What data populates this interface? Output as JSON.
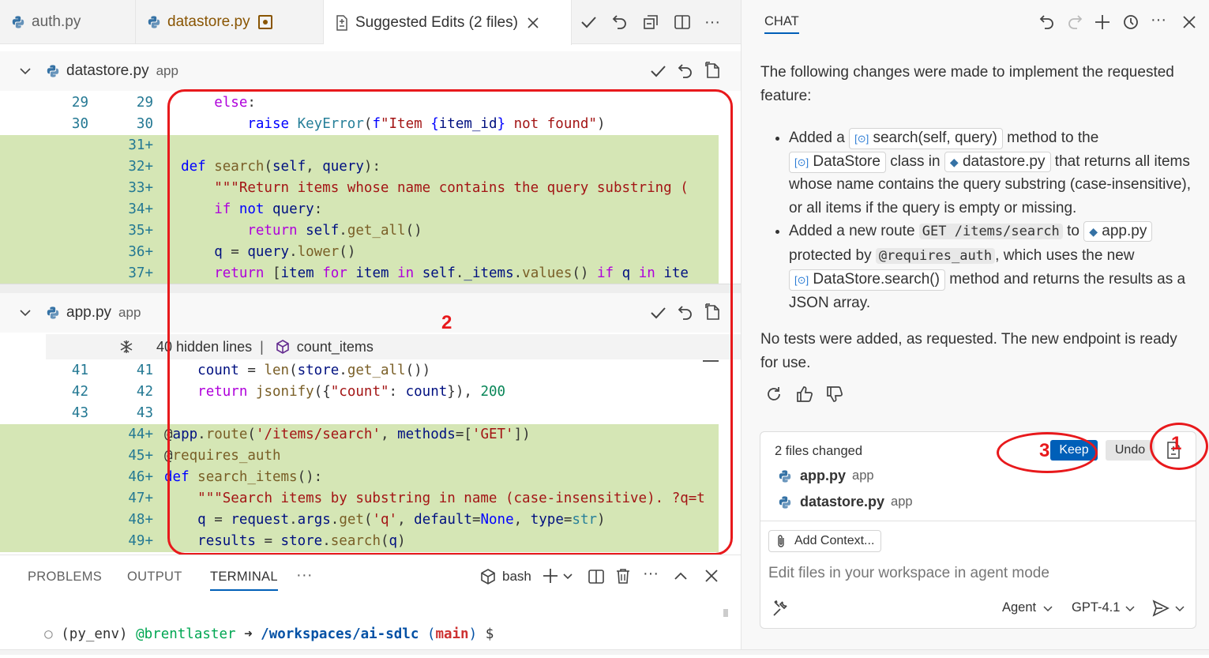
{
  "editor": {
    "tabs": [
      {
        "label": "auth.py"
      },
      {
        "label": "datastore.py"
      },
      {
        "label": "Suggested Edits (2 files)"
      }
    ],
    "sections": [
      {
        "file": "datastore.py",
        "folder": "app"
      },
      {
        "file": "app.py",
        "folder": "app"
      }
    ],
    "hidden_lines": {
      "text": "40 hidden lines",
      "separator": "|",
      "symbol": "count_items"
    }
  },
  "datastore_lines": [
    {
      "l": "29",
      "r": "29",
      "added": false
    },
    {
      "l": "30",
      "r": "30",
      "added": false
    },
    {
      "l": "",
      "r": "31+",
      "added": true
    },
    {
      "l": "",
      "r": "32+",
      "added": true
    },
    {
      "l": "",
      "r": "33+",
      "added": true
    },
    {
      "l": "",
      "r": "34+",
      "added": true
    },
    {
      "l": "",
      "r": "35+",
      "added": true
    },
    {
      "l": "",
      "r": "36+",
      "added": true
    },
    {
      "l": "",
      "r": "37+",
      "added": true
    }
  ],
  "app_lines": [
    {
      "l": "41",
      "r": "41",
      "added": false
    },
    {
      "l": "42",
      "r": "42",
      "added": false
    },
    {
      "l": "43",
      "r": "43",
      "added": false
    },
    {
      "l": "",
      "r": "44+",
      "added": true
    },
    {
      "l": "",
      "r": "45+",
      "added": true
    },
    {
      "l": "",
      "r": "46+",
      "added": true
    },
    {
      "l": "",
      "r": "47+",
      "added": true
    },
    {
      "l": "",
      "r": "48+",
      "added": true
    },
    {
      "l": "",
      "r": "49+",
      "added": true
    }
  ],
  "annotations": {
    "n1": "1",
    "n2": "2",
    "n3": "3"
  },
  "panel": {
    "tabs": [
      "PROBLEMS",
      "OUTPUT",
      "TERMINAL",
      "···"
    ],
    "shell": "bash",
    "prompt": {
      "env": "(py_env)",
      "user": "@brentlaster",
      "arrow": "➜",
      "path": "/workspaces/ai-sdlc",
      "branch_open": "(",
      "branch": "main",
      "branch_close": ")",
      "sign": "$"
    }
  },
  "chat": {
    "title": "CHAT",
    "intro": "The following changes were made to implement the requested feature:",
    "bullet1": {
      "p1": "Added a",
      "chip1": "search(self, query)",
      "p2": "method to the",
      "chip2": "DataStore",
      "p3": "class in",
      "chip3": "datastore.py",
      "p4": "that returns all items whose name contains the query substring (case-insensitive), or all items if the query is empty or missing."
    },
    "bullet2": {
      "p1": "Added a new route",
      "code1": "GET /items/search",
      "p2": "to",
      "chip1": "app.py",
      "p3": "protected by",
      "code2": "@requires_auth",
      "p4": ", which uses the new",
      "chip2": "DataStore.search()",
      "p5": "method and returns the results as a JSON array."
    },
    "closing": "No tests were added, as requested. The new endpoint is ready for use.",
    "changes": {
      "title": "2 files changed",
      "keep": "Keep",
      "undo": "Undo",
      "files": [
        {
          "name": "app.py",
          "folder": "app"
        },
        {
          "name": "datastore.py",
          "folder": "app"
        }
      ]
    },
    "add_context": "Add Context...",
    "input_placeholder": "Edit files in your workspace in agent mode",
    "mode": "Agent",
    "model": "GPT-4.1"
  },
  "colors": {
    "accent": "#005fb8",
    "added_bg": "#d5e6b5",
    "annotation": "#e8191c"
  }
}
